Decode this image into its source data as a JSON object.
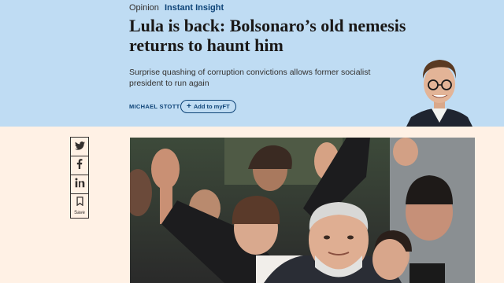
{
  "header": {
    "category": "Opinion",
    "tag": "Instant Insight",
    "headline": "Lula is back: Bolsonaro’s old nemesis returns to haunt him",
    "standfirst": "Surprise quashing of corruption convictions allows former socialist president to run again",
    "author": "MICHAEL STOTT",
    "add_button_label": "Add to myFT"
  },
  "share": {
    "items": [
      {
        "icon": "twitter-icon"
      },
      {
        "icon": "facebook-icon"
      },
      {
        "icon": "linkedin-icon"
      },
      {
        "icon": "bookmark-icon",
        "label": "Save"
      }
    ]
  },
  "colors": {
    "header_bg": "#bfdcf3",
    "page_bg": "#fff1e5",
    "accent": "#0d4377"
  }
}
